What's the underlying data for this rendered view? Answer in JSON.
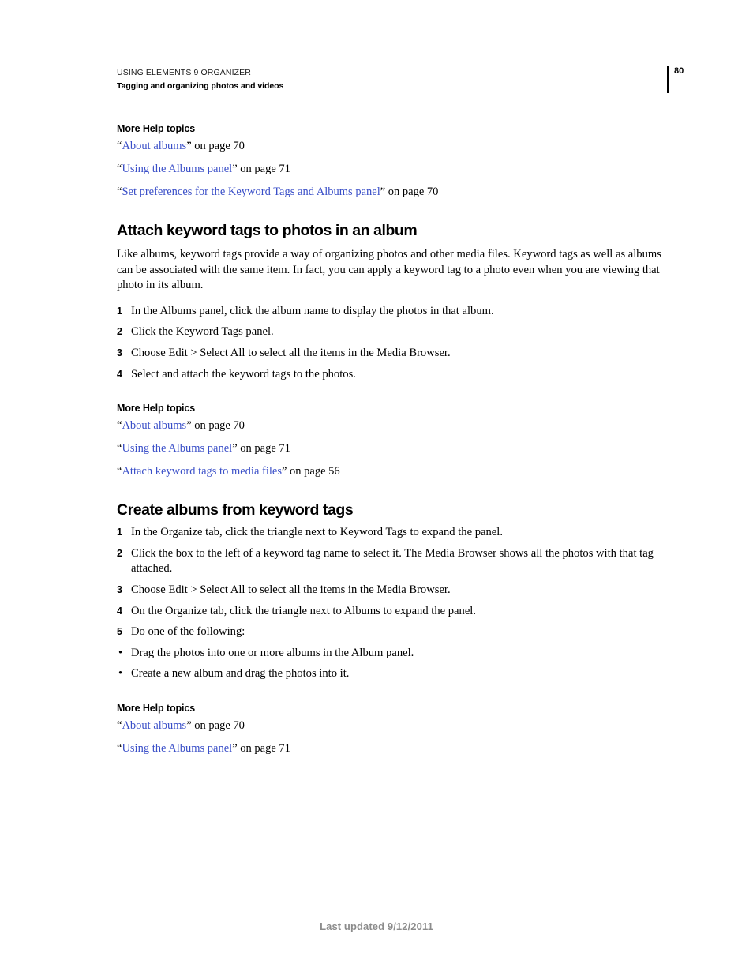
{
  "document": {
    "running_header": {
      "product_line": "USING ELEMENTS 9 ORGANIZER",
      "chapter_line": "Tagging and organizing photos and videos",
      "page_number": "80"
    },
    "footer": {
      "last_updated": "Last updated 9/12/2011"
    },
    "colors": {
      "link": "#3a4fc8",
      "text": "#000000",
      "footer_text": "#8c8c8c",
      "background": "#ffffff"
    }
  },
  "sections": [
    {
      "kind": "more-help-topics",
      "title": "More Help topics",
      "links": [
        {
          "open_quote": "“",
          "label": "About albums",
          "close_quote": "”",
          "suffix": " on page 70"
        },
        {
          "open_quote": "“",
          "label": "Using the Albums panel",
          "close_quote": "”",
          "suffix": " on page 71"
        },
        {
          "open_quote": "“",
          "label": "Set preferences for the Keyword Tags and Albums panel",
          "close_quote": "”",
          "suffix": " on page 70"
        }
      ]
    },
    {
      "kind": "topic",
      "heading": "Attach keyword tags to photos in an album",
      "body": "Like albums, keyword tags provide a way of organizing photos and other media files. Keyword tags as well as albums can be associated with the same item. In fact, you can apply a keyword tag to a photo even when you are viewing that photo in its album.",
      "steps": [
        {
          "marker": "1",
          "type": "number",
          "text": "In the Albums panel, click the album name to display the photos in that album."
        },
        {
          "marker": "2",
          "type": "number",
          "text": "Click the Keyword Tags panel."
        },
        {
          "marker": "3",
          "type": "number",
          "text": "Choose Edit > Select All to select all the items in the Media Browser."
        },
        {
          "marker": "4",
          "type": "number",
          "text": "Select and attach the keyword tags to the photos."
        }
      ]
    },
    {
      "kind": "more-help-topics",
      "title": "More Help topics",
      "links": [
        {
          "open_quote": "“",
          "label": "About albums",
          "close_quote": "”",
          "suffix": " on page 70"
        },
        {
          "open_quote": "“",
          "label": "Using the Albums panel",
          "close_quote": "”",
          "suffix": " on page 71"
        },
        {
          "open_quote": "“",
          "label": "Attach keyword tags to media files",
          "close_quote": "”",
          "suffix": " on page 56"
        }
      ]
    },
    {
      "kind": "topic",
      "heading": "Create albums from keyword tags",
      "body": "",
      "steps": [
        {
          "marker": "1",
          "type": "number",
          "text": "In the Organize tab, click the triangle next to Keyword Tags to expand the panel."
        },
        {
          "marker": "2",
          "type": "number",
          "text": "Click the box to the left of a keyword tag name to select it. The Media Browser shows all the photos with that tag attached."
        },
        {
          "marker": "3",
          "type": "number",
          "text": "Choose Edit > Select All to select all the items in the Media Browser."
        },
        {
          "marker": "4",
          "type": "number",
          "text": "On the Organize tab, click the triangle next to Albums to expand the panel."
        },
        {
          "marker": "5",
          "type": "number",
          "text": "Do one of the following:"
        },
        {
          "marker": "•",
          "type": "bullet",
          "text": "Drag the photos into one or more albums in the Album panel."
        },
        {
          "marker": "•",
          "type": "bullet",
          "text": "Create a new album and drag the photos into it."
        }
      ]
    },
    {
      "kind": "more-help-topics",
      "title": "More Help topics",
      "links": [
        {
          "open_quote": "“",
          "label": "About albums",
          "close_quote": "”",
          "suffix": " on page 70"
        },
        {
          "open_quote": "“",
          "label": "Using the Albums panel",
          "close_quote": "”",
          "suffix": " on page 71"
        }
      ]
    }
  ]
}
